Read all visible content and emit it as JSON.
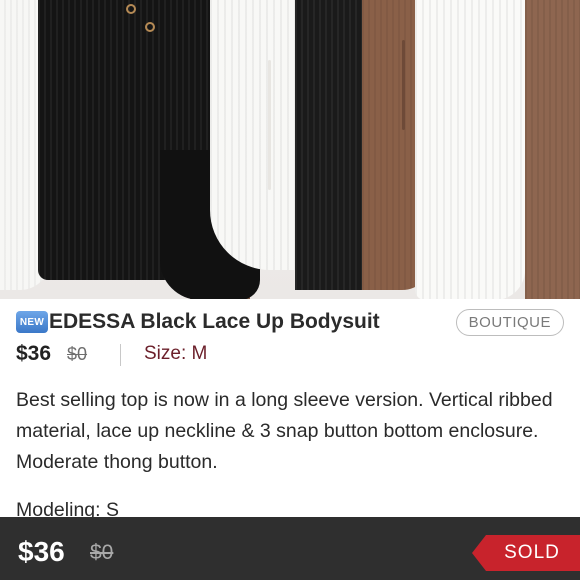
{
  "listing": {
    "badge": "NEW",
    "title": "EDESSA Black Lace Up Bodysuit",
    "category_chip": "BOUTIQUE",
    "price": "$36",
    "original_price": "$0",
    "size": "Size: M",
    "description": "Best selling top is now in a long sleeve version. Vertical ribbed material, lace up neckline & 3 snap button bottom enclosure. Moderate thong button.",
    "modeling": "Modeling: S"
  },
  "bottom_bar": {
    "price": "$36",
    "original_price": "$0",
    "status": "SOLD"
  },
  "colors": {
    "accent_size": "#6b1f2a",
    "sold_red": "#c8232c",
    "bar_bg": "#2f2f2f",
    "badge_blue": "#3b78c8"
  }
}
